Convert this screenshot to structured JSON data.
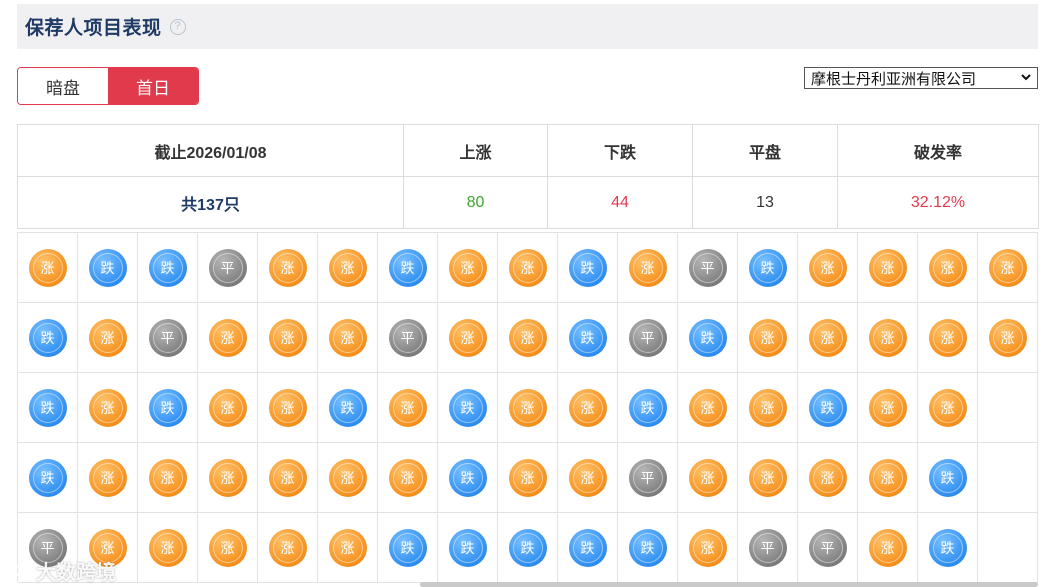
{
  "header": {
    "title": "保荐人项目表现",
    "help": "?"
  },
  "tabs": [
    {
      "label": "暗盘",
      "active": false
    },
    {
      "label": "首日",
      "active": true
    }
  ],
  "sponsor_select": {
    "value": "摩根士丹利亚洲有限公司"
  },
  "summary": {
    "headers": [
      "截止2026/01/08",
      "上涨",
      "下跌",
      "平盘",
      "破发率"
    ],
    "total": "共137只",
    "up": "80",
    "down": "44",
    "flat": "13",
    "break_rate": "32.12%"
  },
  "labels": {
    "up": "涨",
    "down": "跌",
    "flat": "平"
  },
  "colors": {
    "up": "#f5901d",
    "down": "#2f8ef0",
    "flat": "#7d7d7d",
    "accent": "#e03a4c",
    "title": "#1f3a64"
  },
  "grid_rows": [
    [
      "up",
      "down",
      "down",
      "flat",
      "up",
      "up",
      "down",
      "up",
      "up",
      "down",
      "up",
      "flat",
      "down",
      "up",
      "up",
      "up",
      "up"
    ],
    [
      "down",
      "up",
      "flat",
      "up",
      "up",
      "up",
      "flat",
      "up",
      "up",
      "down",
      "flat",
      "down",
      "up",
      "up",
      "up",
      "up",
      "up"
    ],
    [
      "down",
      "up",
      "down",
      "up",
      "up",
      "down",
      "up",
      "down",
      "up",
      "up",
      "down",
      "up",
      "up",
      "down",
      "up",
      "up",
      ""
    ],
    [
      "down",
      "up",
      "up",
      "up",
      "up",
      "up",
      "up",
      "down",
      "up",
      "up",
      "flat",
      "up",
      "up",
      "up",
      "up",
      "down",
      ""
    ],
    [
      "flat",
      "up",
      "up",
      "up",
      "up",
      "up",
      "down",
      "down",
      "down",
      "down",
      "down",
      "up",
      "flat",
      "flat",
      "up",
      "down",
      ""
    ]
  ],
  "watermark": "大数跨境"
}
